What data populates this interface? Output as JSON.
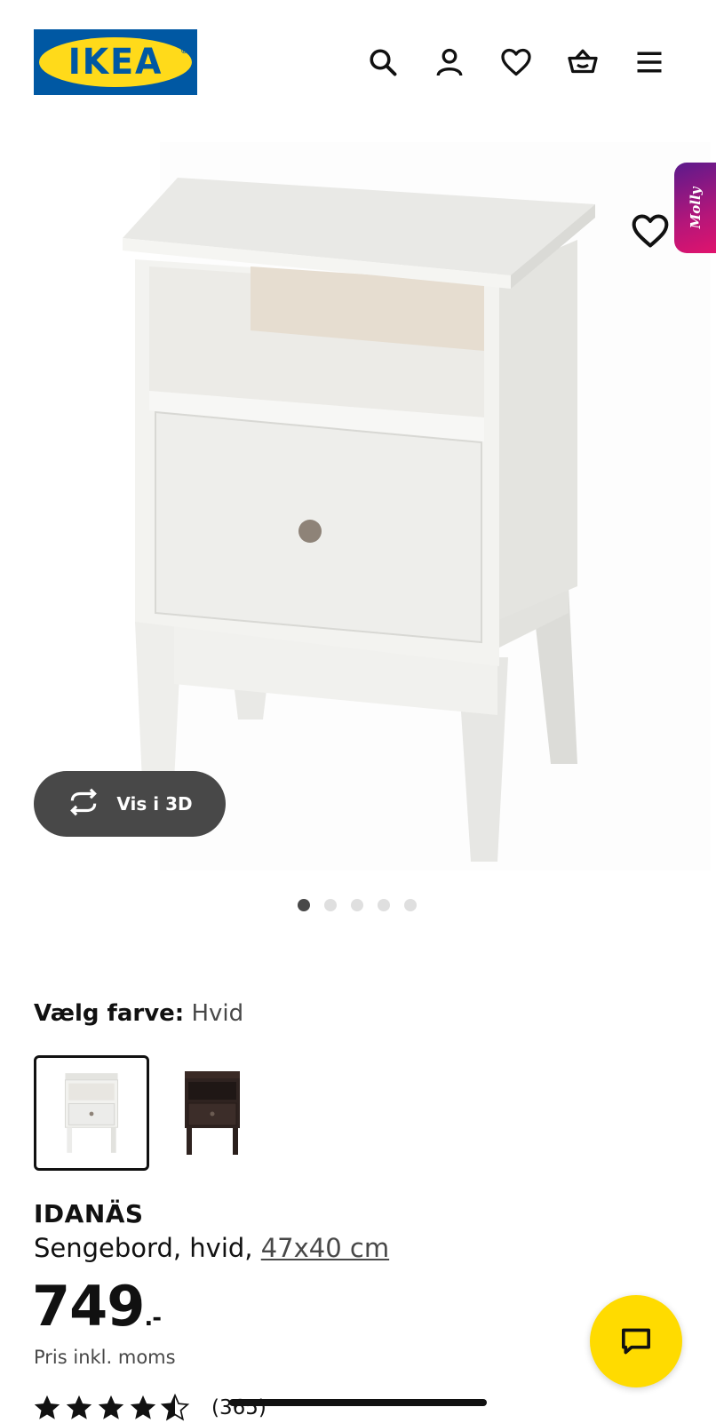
{
  "header": {
    "logo_text": "IKEA",
    "icons": [
      "search-icon",
      "account-icon",
      "heart-icon",
      "basket-icon",
      "menu-icon"
    ]
  },
  "gallery": {
    "molly_label": "Molly",
    "vis3d_label": "Vis i 3D",
    "dots_total": 5,
    "dots_active": 1
  },
  "color": {
    "label": "Vælg farve:",
    "value": "Hvid",
    "swatches": [
      "white",
      "dark-brown"
    ],
    "selected": "white"
  },
  "product": {
    "name": "IDANÄS",
    "desc_prefix": "Sengebord, hvid, ",
    "dimensions": "47x40 cm",
    "price": "749",
    "price_suffix": ".-",
    "price_note": "Pris inkl. moms",
    "rating_value": 4.5,
    "rating_count": "(365)"
  },
  "colors": {
    "ikea_blue": "#0058a3",
    "ikea_yellow": "#ffda1a",
    "chat_yellow": "#ffdb00",
    "pill_dark": "#484848"
  }
}
